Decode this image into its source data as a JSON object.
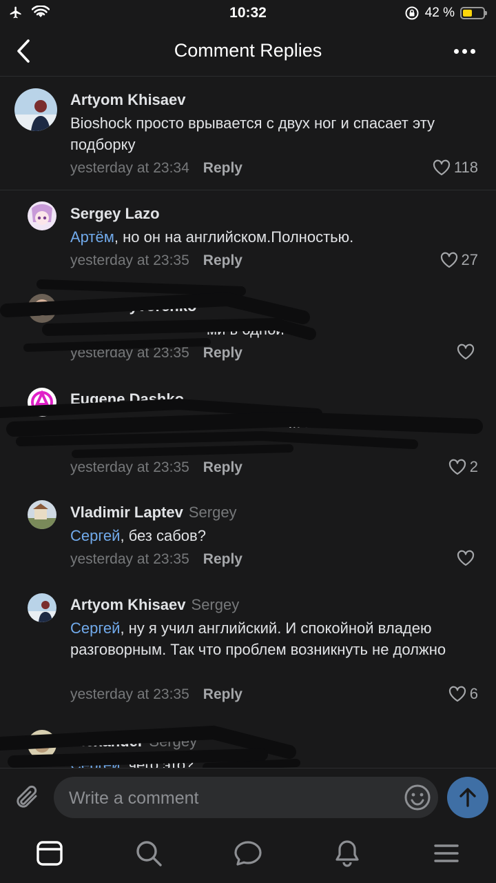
{
  "status_bar": {
    "time": "10:32",
    "battery": "42 %"
  },
  "header": {
    "title": "Comment Replies",
    "back_icon": "chevron-left-icon",
    "more_icon": "more-dots-icon"
  },
  "comments": [
    {
      "author": "Artyom Khisaev",
      "reply_to": "",
      "mention": "",
      "text": "Bioshock просто врывается с двух ног и спасает эту подборку",
      "time": "yesterday at 23:34",
      "reply_label": "Reply",
      "likes": "118"
    },
    {
      "author": "Sergey Lazo",
      "reply_to": "",
      "mention": "Артём",
      "text": ", но он на английском.Полностью.",
      "time": "yesterday at 23:35",
      "reply_label": "Reply",
      "likes": "27"
    },
    {
      "author": "Vadim Syvorenko",
      "reply_to": "",
      "mention": "",
      "text": "ми в одной",
      "time": "yesterday at 23:35",
      "reply_label": "Reply",
      "likes": ""
    },
    {
      "author": "Eugene Dashko",
      "reply_to": "",
      "mention": "",
      "text": "ж атив",
      "time": "yesterday at 23:35",
      "reply_label": "Reply",
      "likes": "2"
    },
    {
      "author": "Vladimir Laptev",
      "reply_to": "Sergey",
      "mention": "Сергей",
      "text": ", без сабов?",
      "time": "yesterday at 23:35",
      "reply_label": "Reply",
      "likes": ""
    },
    {
      "author": "Artyom Khisaev",
      "reply_to": "Sergey",
      "mention": "Сергей",
      "text": ", ну я учил английский. И спокойной владею разговорным. Так что проблем возникнуть не должно",
      "time": "yesterday at 23:35",
      "reply_label": "Reply",
      "likes": "6"
    },
    {
      "author": "Alexander",
      "reply_to": "Sergey",
      "mention": "Сергей",
      "text": ", чего это?",
      "time": "",
      "reply_label": "",
      "likes": ""
    }
  ],
  "composer": {
    "placeholder": "Write a comment"
  },
  "tabs": [
    "home-tab-icon",
    "search-tab-icon",
    "messages-tab-icon",
    "notifications-tab-icon",
    "menu-tab-icon"
  ],
  "colors": {
    "background": "#19191a",
    "accent": "#71aaeb",
    "send_button": "#3f6fa5",
    "secondary_text": "#76787a"
  }
}
